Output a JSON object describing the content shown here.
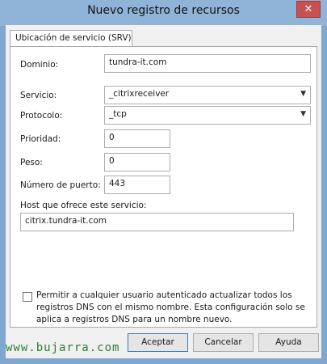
{
  "window": {
    "title": "Nuevo registro de recursos",
    "close_glyph": "✕"
  },
  "tab": {
    "label": "Ubicación de servicio (SRV)"
  },
  "form": {
    "dominio": {
      "label": "Dominio:",
      "value": "tundra-it.com"
    },
    "servicio": {
      "label": "Servicio:",
      "value": "_citrixreceiver"
    },
    "protocolo": {
      "label": "Protocolo:",
      "value": "_tcp"
    },
    "prioridad": {
      "label": "Prioridad:",
      "value": "0"
    },
    "peso": {
      "label": "Peso:",
      "value": "0"
    },
    "puerto": {
      "label": "Número de puerto:",
      "value": "443"
    },
    "host": {
      "label": "Host que ofrece este servicio:",
      "value": "citrix.tundra-it.com"
    },
    "permitir": {
      "text": "Permitir a cualquier usuario autenticado actualizar todos los registros DNS con el mismo nombre. Esta configuración solo se aplica a registros DNS para un nombre nuevo.",
      "checked": false
    }
  },
  "buttons": {
    "ok": "Aceptar",
    "cancel": "Cancelar",
    "help": "Ayuda"
  },
  "watermark": "www.bujarra.com",
  "colors": {
    "titlebar": "#8fb4d8",
    "close": "#c75050",
    "watermark": "#2e7d32"
  },
  "icons": {
    "dropdown": "chevron-down-icon",
    "close": "close-icon"
  }
}
